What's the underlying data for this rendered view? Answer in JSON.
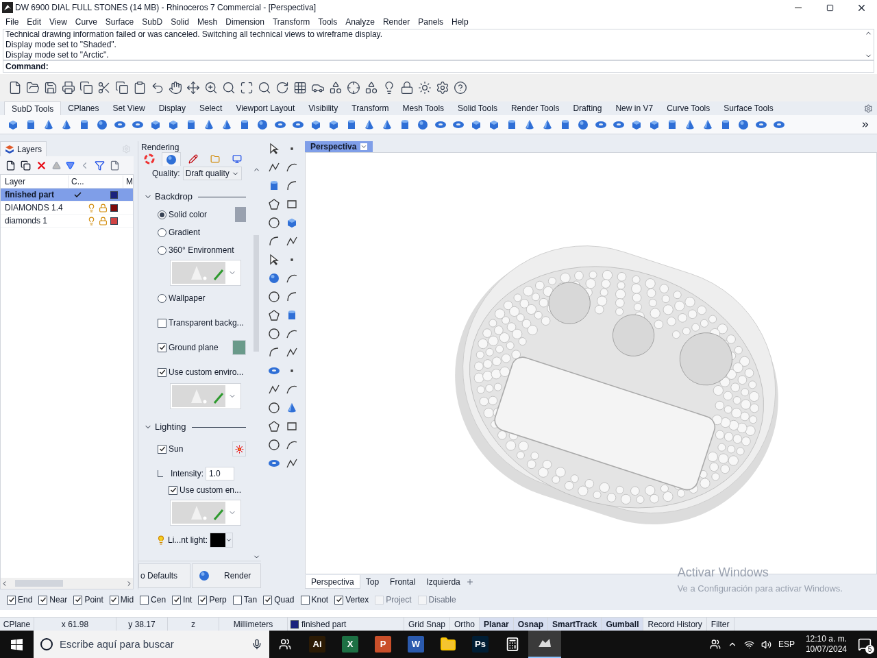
{
  "window": {
    "title": "DW 6900 DIAL FULL STONES (14 MB) - Rhinoceros 7 Commercial - [Perspectiva]"
  },
  "menu": [
    "File",
    "Edit",
    "View",
    "Curve",
    "Surface",
    "SubD",
    "Solid",
    "Mesh",
    "Dimension",
    "Transform",
    "Tools",
    "Analyze",
    "Render",
    "Panels",
    "Help"
  ],
  "command_history": [
    "Technical drawing information failed or was canceled. Switching all technical views to wireframe display.",
    "Display mode set to \"Shaded\".",
    "Display mode set to \"Arctic\"."
  ],
  "command_prompt": "Command:",
  "toolbar_tabs": [
    {
      "label": "SubD Tools",
      "selected": true
    },
    {
      "label": "CPlanes",
      "selected": false
    },
    {
      "label": "Set View",
      "selected": false
    },
    {
      "label": "Display",
      "selected": false
    },
    {
      "label": "Select",
      "selected": false
    },
    {
      "label": "Viewport Layout",
      "selected": false
    },
    {
      "label": "Visibility",
      "selected": false
    },
    {
      "label": "Transform",
      "selected": false
    },
    {
      "label": "Mesh Tools",
      "selected": false
    },
    {
      "label": "Solid Tools",
      "selected": false
    },
    {
      "label": "Render Tools",
      "selected": false
    },
    {
      "label": "Drafting",
      "selected": false
    },
    {
      "label": "New in V7",
      "selected": false
    },
    {
      "label": "Curve Tools",
      "selected": false
    },
    {
      "label": "Surface Tools",
      "selected": false
    }
  ],
  "layers_panel": {
    "tab": "Layers",
    "columns": [
      "Layer",
      "C...",
      "M"
    ],
    "rows": [
      {
        "name": "finished part",
        "selected": true,
        "current": true,
        "color": "#1a237e"
      },
      {
        "name": "DIAMONDS 1.4",
        "selected": false,
        "current": false,
        "color": "#7f0a0a"
      },
      {
        "name": "diamonds 1",
        "selected": false,
        "current": false,
        "color": "#d04444"
      }
    ]
  },
  "rendering_panel": {
    "title": "Rendering",
    "tabs": [
      {
        "kind": "color-wheel",
        "selected": false
      },
      {
        "kind": "sphere",
        "selected": true
      },
      {
        "kind": "brush",
        "selected": false
      },
      {
        "kind": "folder",
        "selected": false
      },
      {
        "kind": "window",
        "selected": false
      }
    ],
    "quality_label": "Quality:",
    "quality": "Draft quality",
    "backdrop": {
      "title": "Backdrop",
      "expanded": true,
      "options": [
        {
          "label": "Solid color",
          "selected": true
        },
        {
          "label": "Gradient",
          "selected": false
        },
        {
          "label": "360° Environment",
          "selected": false
        },
        {
          "label": "Wallpaper",
          "selected": false
        }
      ],
      "checks": [
        {
          "label": "Transparent backg...",
          "checked": false
        },
        {
          "label": "Ground plane",
          "checked": true
        },
        {
          "label": "Use custom enviro...",
          "checked": true
        }
      ]
    },
    "lighting": {
      "title": "Lighting",
      "expanded": true,
      "sun": {
        "label": "Sun",
        "checked": true
      },
      "intensity_label": "Intensity:",
      "intensity": "1.0",
      "custom": {
        "label": "Use custom en...",
        "checked": true
      },
      "light_label": "Li...nt light:"
    },
    "buttons": [
      "o Defaults",
      "Render"
    ]
  },
  "viewport": {
    "title": "Perspectiva",
    "tabs": [
      {
        "label": "Perspectiva",
        "selected": true
      },
      {
        "label": "Top",
        "selected": false
      },
      {
        "label": "Frontal",
        "selected": false
      },
      {
        "label": "Izquierda",
        "selected": false
      }
    ],
    "activation": [
      "Activar Windows",
      "Ve a Configuración para activar Windows."
    ]
  },
  "osnaps": [
    {
      "label": "End",
      "checked": true,
      "disabled": false
    },
    {
      "label": "Near",
      "checked": true,
      "disabled": false
    },
    {
      "label": "Point",
      "checked": true,
      "disabled": false
    },
    {
      "label": "Mid",
      "checked": true,
      "disabled": false
    },
    {
      "label": "Cen",
      "checked": false,
      "disabled": false
    },
    {
      "label": "Int",
      "checked": true,
      "disabled": false
    },
    {
      "label": "Perp",
      "checked": true,
      "disabled": false
    },
    {
      "label": "Tan",
      "checked": false,
      "disabled": false
    },
    {
      "label": "Quad",
      "checked": true,
      "disabled": false
    },
    {
      "label": "Knot",
      "checked": false,
      "disabled": false
    },
    {
      "label": "Vertex",
      "checked": true,
      "disabled": false
    },
    {
      "label": "Project",
      "checked": false,
      "disabled": true
    },
    {
      "label": "Disable",
      "checked": false,
      "disabled": true
    }
  ],
  "status_bar": {
    "cells": [
      "CPlane",
      "x 61.98",
      "y 38.17",
      "z",
      "Millimeters"
    ],
    "layer": {
      "name": "finished part",
      "color": "#1a237e"
    },
    "toggles": [
      {
        "label": "Grid Snap",
        "on": false
      },
      {
        "label": "Ortho",
        "on": false
      },
      {
        "label": "Planar",
        "on": true
      },
      {
        "label": "Osnap",
        "on": true
      },
      {
        "label": "SmartTrack",
        "on": true
      },
      {
        "label": "Gumball",
        "on": true
      },
      {
        "label": "Record History",
        "on": false
      },
      {
        "label": "Filter",
        "on": false
      }
    ]
  },
  "taskbar": {
    "search_placeholder": "Escribe aquí para buscar",
    "apps": [
      {
        "label": "Ai",
        "color": "#2b1a04",
        "selected": false
      },
      {
        "label": "X",
        "color": "#1d7044",
        "selected": false
      },
      {
        "label": "P",
        "color": "#c94f2a",
        "selected": false
      },
      {
        "label": "W",
        "color": "#2b5aad",
        "selected": false
      },
      {
        "label": "Ps",
        "color": "#001d34",
        "selected": false
      }
    ],
    "language": "ESP",
    "time": "12:10 a. m.",
    "date": "10/07/2024",
    "notifications": "5"
  }
}
